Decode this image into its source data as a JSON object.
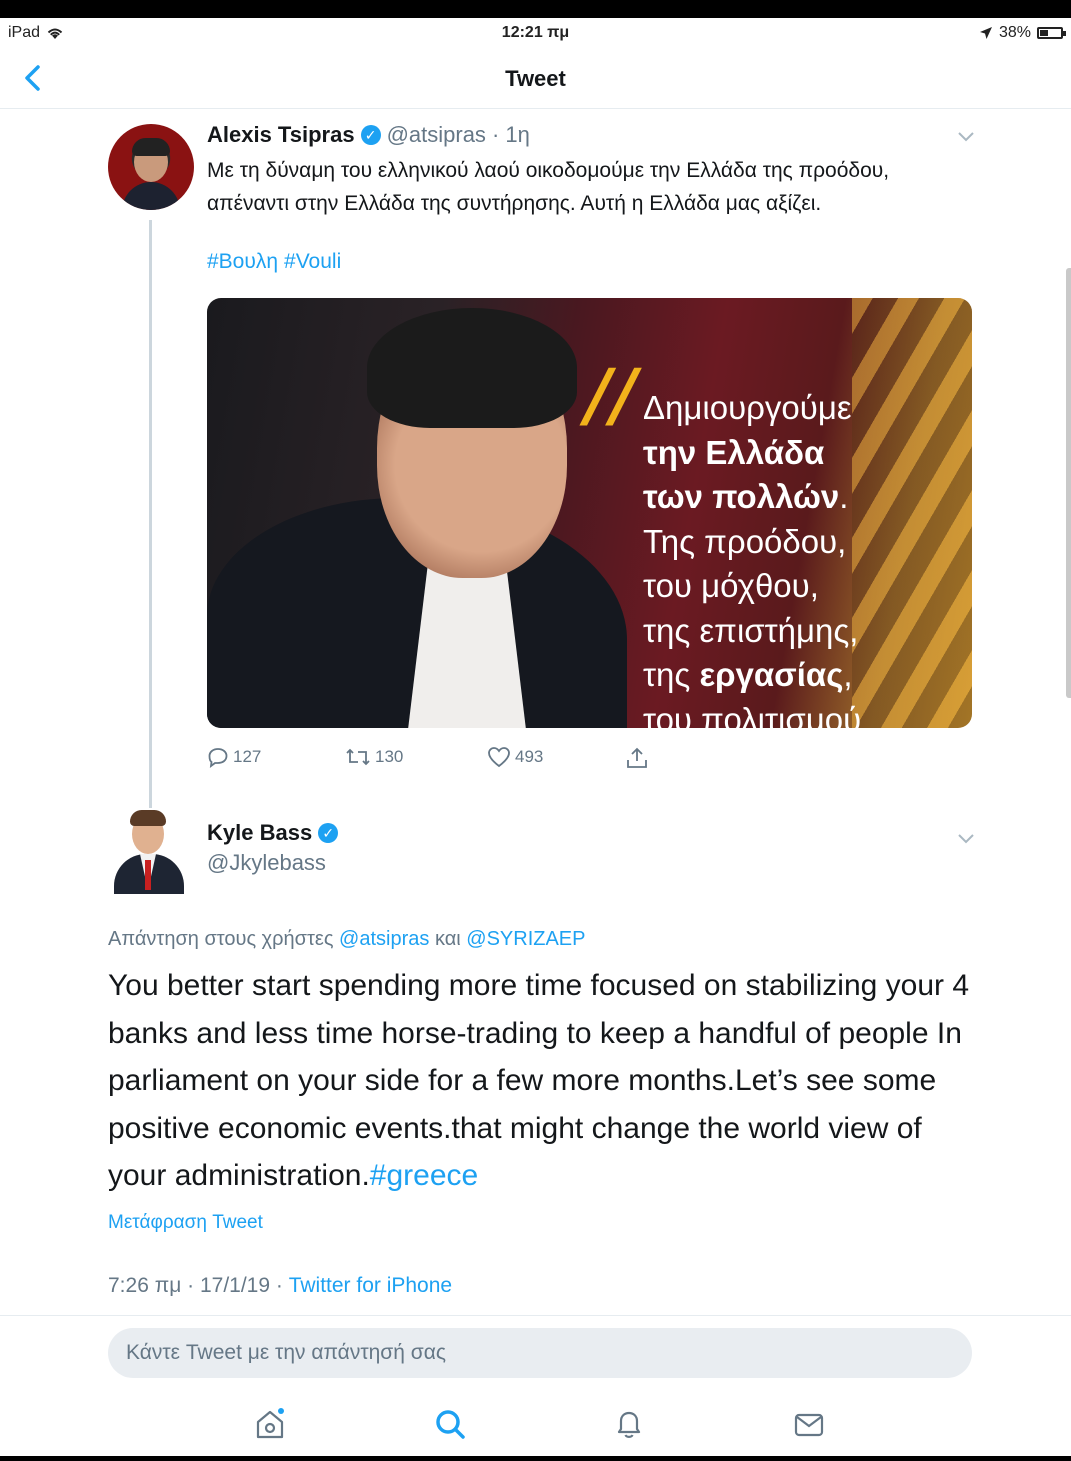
{
  "status_bar": {
    "device": "iPad",
    "time": "12:21 πμ",
    "battery": "38%",
    "battery_level": 0.38
  },
  "nav": {
    "title": "Tweet"
  },
  "tweet": {
    "author_name": "Alexis Tsipras",
    "author_handle": "@atsipras",
    "age": "· 1η",
    "text": "Με τη δύναμη του ελληνικού λαού οικοδομούμε την Ελλάδα της προόδου, απέναντι στην Ελλάδα της συντήρησης. Αυτή η Ελλάδα μας αξίζει.",
    "hashtags": [
      "#Βουλη",
      "#Vouli"
    ],
    "media_quote": {
      "line1": "Δημιουργούμε",
      "line2": "την Ελλάδα",
      "line3": "των πολλών",
      "line3_dot": ".",
      "line4": "Της προόδου,",
      "line5": "του μόχθου,",
      "line6": "της επιστήμης,",
      "line7_prefix": "της ",
      "line7_bold": "εργασίας",
      "line7_suffix": ",",
      "line8": "του πολιτισμού"
    },
    "replies": "127",
    "retweets": "130",
    "likes": "493"
  },
  "reply": {
    "author_name": "Kyle Bass",
    "author_handle": "@Jkylebass",
    "replying_prefix": "Απάντηση στους χρήστες ",
    "replying_user1": "@atsipras",
    "replying_join": " και ",
    "replying_user2": "@SYRIZAEP",
    "text": "You better start spending more time focused on stabilizing your 4 banks and less time horse-trading to keep a handful of people In parliament on your side for a few more months.Let’s see some positive economic events.that might change the world view of your administration.",
    "hashtag": "#greece",
    "translate_label": "Μετάφραση Tweet",
    "timestamp": "7:26 πμ · 17/1/19 · ",
    "source": "Twitter for iPhone"
  },
  "compose": {
    "placeholder": "Κάντε Tweet με την απάντησή σας"
  },
  "tabs": [
    "home-icon",
    "search-icon",
    "notifications-icon",
    "messages-icon"
  ],
  "colors": {
    "accent": "#1da1f2",
    "secondary_text": "#657786",
    "quote_mark": "#f2b21b"
  }
}
